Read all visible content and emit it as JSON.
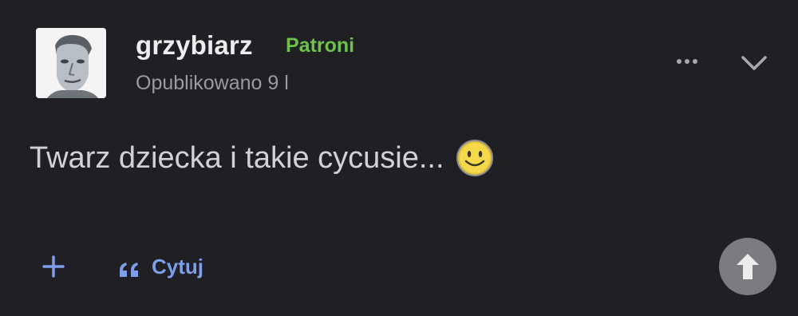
{
  "post": {
    "author": {
      "username": "grzybiarz",
      "group": "Patroni",
      "group_color": "#6cc24a"
    },
    "published_label": "Opublikowano 9 l",
    "body_text": "Twarz dziecka i takie cycusie...",
    "emoji": "smiley-icon"
  },
  "actions": {
    "add_symbol": "+",
    "quote_symbol": "66",
    "quote_label": "Cytuj",
    "accent_color": "#7e9dea"
  },
  "icons": {
    "menu": "ellipsis-icon",
    "collapse": "chevron-down-icon",
    "scroll_top": "arrow-up-icon"
  }
}
